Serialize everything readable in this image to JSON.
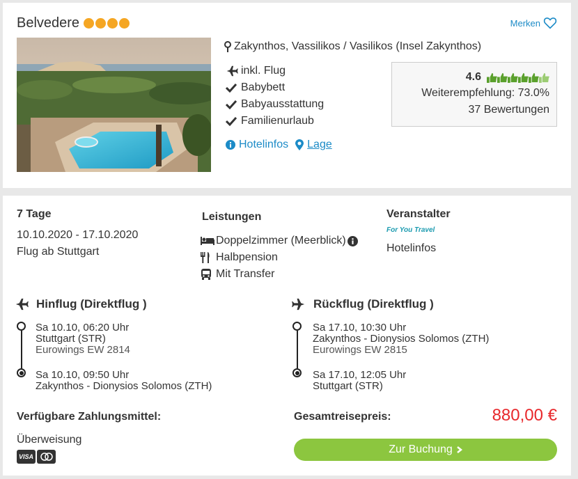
{
  "hotel": {
    "name": "Belvedere",
    "star_count": 4,
    "star_color": "#f5a623",
    "merken_label": "Merken",
    "location": "Zakynthos, Vassilikos / Vasilikos (Insel Zakynthos)",
    "features": [
      {
        "icon": "plane-icon",
        "label": "inkl. Flug"
      },
      {
        "icon": "check-icon",
        "label": "Babybett"
      },
      {
        "icon": "check-icon",
        "label": "Babyausstattung"
      },
      {
        "icon": "check-icon",
        "label": "Familienurlaub"
      }
    ],
    "links": {
      "hotelinfos": "Hotelinfos",
      "lage": "Lage"
    },
    "rating": {
      "score": "4.6",
      "thumbs_filled": 5,
      "thumbs_total": 6,
      "recommendation": "Weiterempfehlung: 73.0%",
      "reviews": "37 Bewertungen"
    }
  },
  "trip": {
    "duration": "7 Tage",
    "dates": "10.10.2020 - 17.10.2020",
    "departure": "Flug ab Stuttgart",
    "leistungen_title": "Leistungen",
    "leistungen": [
      {
        "icon": "bed-icon",
        "label": "Doppelzimmer (Meerblick)"
      },
      {
        "icon": "cutlery-icon",
        "label": "Halbpension"
      },
      {
        "icon": "bus-icon",
        "label": "Mit Transfer"
      }
    ],
    "veranstalter_title": "Veranstalter",
    "veranstalter_logo": "For You Travel",
    "veranstalter_link": "Hotelinfos"
  },
  "flights": {
    "outbound": {
      "title": "Hinflug (Direktflug )",
      "departure": {
        "time": "Sa 10.10, 06:20 Uhr",
        "airport": "Stuttgart (STR)",
        "airline": "Eurowings EW 2814"
      },
      "arrival": {
        "time": "Sa 10.10, 09:50 Uhr",
        "airport": "Zakynthos - Dionysios Solomos (ZTH)"
      }
    },
    "return": {
      "title": "Rückflug (Direktflug )",
      "departure": {
        "time": "Sa 17.10, 10:30 Uhr",
        "airport": "Zakynthos - Dionysios Solomos (ZTH)",
        "airline": "Eurowings EW 2815"
      },
      "arrival": {
        "time": "Sa 17.10, 12:05 Uhr",
        "airport": "Stuttgart (STR)"
      }
    }
  },
  "payment": {
    "title": "Verfügbare Zahlungsmittel:",
    "method": "Überweisung",
    "cards": [
      "VISA",
      "MC"
    ]
  },
  "price": {
    "title": "Gesamtreisepreis:",
    "amount": "880,00 €",
    "button_label": "Zur Buchung"
  },
  "colors": {
    "accent_link": "#1c8bc7",
    "price": "#e8272b",
    "button": "#8cc63f",
    "thumb": "#5aa02c"
  }
}
